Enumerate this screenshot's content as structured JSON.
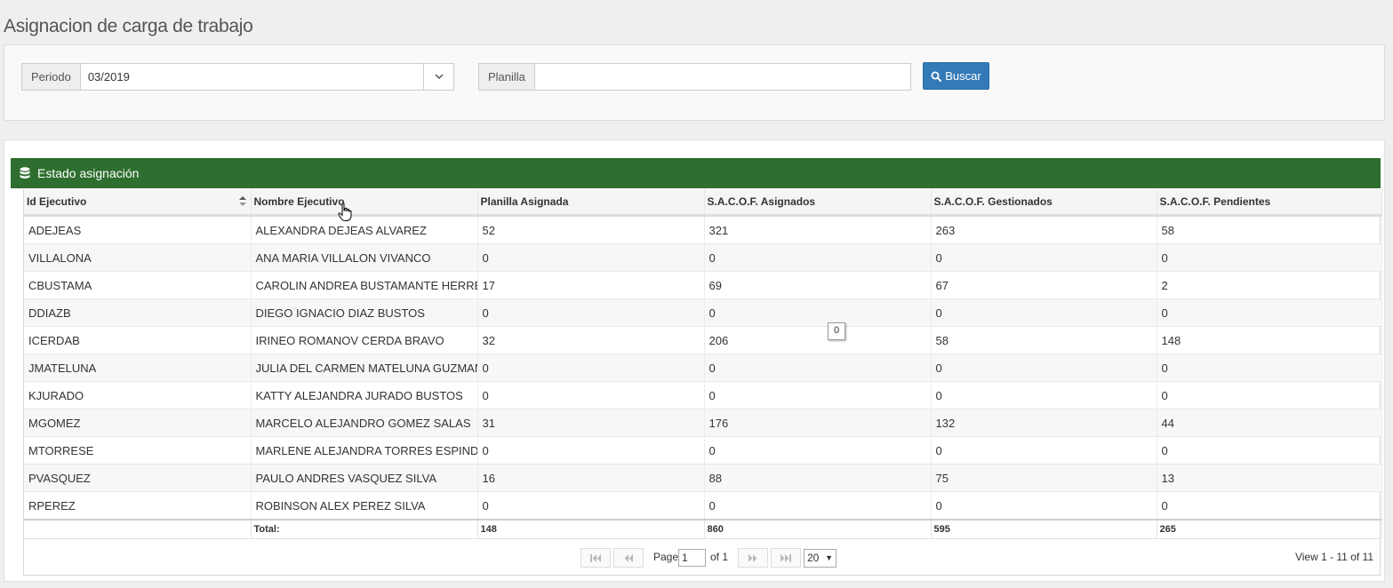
{
  "page": {
    "title": "Asignacion de carga de trabajo"
  },
  "filters": {
    "periodo_label": "Periodo",
    "periodo_value": "03/2019",
    "planilla_label": "Planilla",
    "planilla_value": "",
    "search_button": "Buscar"
  },
  "panel": {
    "title": "Estado asignación"
  },
  "table": {
    "columns": [
      "Id Ejecutivo",
      "Nombre Ejecutivo",
      "Planilla Asignada",
      "S.A.C.O.F. Asignados",
      "S.A.C.O.F. Gestionados",
      "S.A.C.O.F. Pendientes"
    ],
    "rows": [
      [
        "ADEJEAS",
        "ALEXANDRA DEJEAS ALVAREZ",
        "52",
        "321",
        "263",
        "58"
      ],
      [
        "VILLALONA",
        "ANA MARIA VILLALON VIVANCO",
        "0",
        "0",
        "0",
        "0"
      ],
      [
        "CBUSTAMA",
        "CAROLIN ANDREA BUSTAMANTE HERRERA",
        "17",
        "69",
        "67",
        "2"
      ],
      [
        "DDIAZB",
        "DIEGO IGNACIO DIAZ BUSTOS",
        "0",
        "0",
        "0",
        "0"
      ],
      [
        "ICERDAB",
        "IRINEO ROMANOV CERDA BRAVO",
        "32",
        "206",
        "58",
        "148"
      ],
      [
        "JMATELUNA",
        "JULIA DEL CARMEN MATELUNA GUZMAN",
        "0",
        "0",
        "0",
        "0"
      ],
      [
        "KJURADO",
        "KATTY ALEJANDRA JURADO BUSTOS",
        "0",
        "0",
        "0",
        "0"
      ],
      [
        "MGOMEZ",
        "MARCELO ALEJANDRO GOMEZ SALAS",
        "31",
        "176",
        "132",
        "44"
      ],
      [
        "MTORRESE",
        "MARLENE ALEJANDRA TORRES ESPINDOLA",
        "0",
        "0",
        "0",
        "0"
      ],
      [
        "PVASQUEZ",
        "PAULO ANDRES VASQUEZ SILVA",
        "16",
        "88",
        "75",
        "13"
      ],
      [
        "RPEREZ",
        "ROBINSON ALEX PEREZ SILVA",
        "0",
        "0",
        "0",
        "0"
      ]
    ],
    "footer": {
      "label": "Total:",
      "planilla": "148",
      "asignados": "860",
      "gestionados": "595",
      "pendientes": "265"
    }
  },
  "pager": {
    "page_label": "Page",
    "page_value": "1",
    "of_label": "of 1",
    "rows_per_page": "20",
    "view_info": "View 1 - 11 of 11"
  },
  "tooltip": {
    "text": "0"
  },
  "colors": {
    "header_green": "#2e6e2e",
    "primary_blue": "#337ab7"
  }
}
